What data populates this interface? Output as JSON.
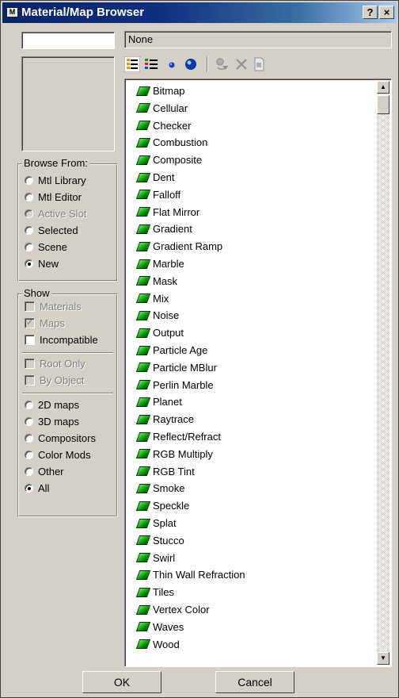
{
  "window": {
    "title": "Material/Map Browser",
    "help_label": "?",
    "close_label": "×"
  },
  "name_field": {
    "value": ""
  },
  "selected_name": "None",
  "browse_from": {
    "legend": "Browse From:",
    "options": [
      {
        "label": "Mtl Library",
        "selected": false,
        "disabled": false
      },
      {
        "label": "Mtl Editor",
        "selected": false,
        "disabled": false
      },
      {
        "label": "Active Slot",
        "selected": false,
        "disabled": true
      },
      {
        "label": "Selected",
        "selected": false,
        "disabled": false
      },
      {
        "label": "Scene",
        "selected": false,
        "disabled": false
      },
      {
        "label": "New",
        "selected": true,
        "disabled": false
      }
    ]
  },
  "show": {
    "legend": "Show",
    "checks": [
      {
        "label": "Materials",
        "checked": false,
        "disabled": true
      },
      {
        "label": "Maps",
        "checked": true,
        "disabled": true
      },
      {
        "label": "Incompatible",
        "checked": false,
        "disabled": false
      }
    ],
    "checks2": [
      {
        "label": "Root Only",
        "checked": false,
        "disabled": true
      },
      {
        "label": "By Object",
        "checked": false,
        "disabled": true
      }
    ],
    "radios": [
      {
        "label": "2D maps",
        "selected": false
      },
      {
        "label": "3D maps",
        "selected": false
      },
      {
        "label": "Compositors",
        "selected": false
      },
      {
        "label": "Color Mods",
        "selected": false
      },
      {
        "label": "Other",
        "selected": false
      },
      {
        "label": "All",
        "selected": true
      }
    ]
  },
  "toolbar": {
    "icons": [
      "view-list-icon",
      "view-list-icons-icon",
      "small-icons-icon",
      "large-icons-icon",
      "update-scene-materials-icon",
      "delete-icon",
      "clear-library-icon"
    ]
  },
  "map_list": [
    "Bitmap",
    "Cellular",
    "Checker",
    "Combustion",
    "Composite",
    "Dent",
    "Falloff",
    "Flat Mirror",
    "Gradient",
    "Gradient Ramp",
    "Marble",
    "Mask",
    "Mix",
    "Noise",
    "Output",
    "Particle Age",
    "Particle MBlur",
    "Perlin Marble",
    "Planet",
    "Raytrace",
    "Reflect/Refract",
    "RGB Multiply",
    "RGB Tint",
    "Smoke",
    "Speckle",
    "Splat",
    "Stucco",
    "Swirl",
    "Thin Wall Refraction",
    "Tiles",
    "Vertex Color",
    "Waves",
    "Wood"
  ],
  "buttons": {
    "ok": "OK",
    "cancel": "Cancel"
  }
}
